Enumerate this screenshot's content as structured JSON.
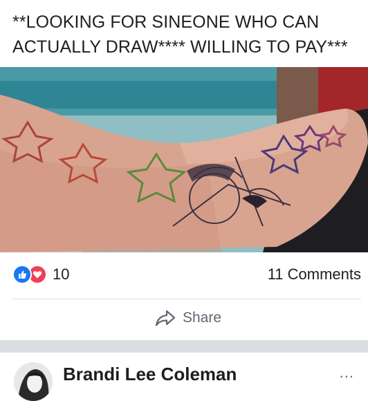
{
  "post": {
    "text": "**LOOKING FOR SINEONE WHO CAN ACTUALLY DRAW**** WILLING TO PAY***"
  },
  "reactions": {
    "count": "10",
    "icons": [
      "like-icon",
      "love-icon"
    ],
    "colors": {
      "like": "#1877f2",
      "love": "#f33e58"
    }
  },
  "comments": {
    "count_label": "11 Comments"
  },
  "actions": {
    "share_label": "Share"
  },
  "comment": {
    "author": "Brandi Lee Coleman",
    "more_label": "..."
  }
}
